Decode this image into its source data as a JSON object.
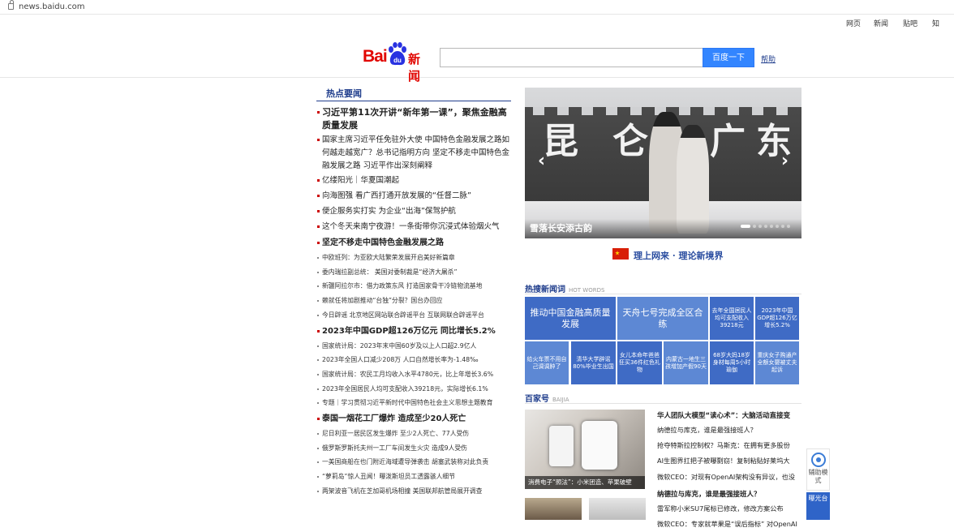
{
  "browser": {
    "url": "news.baidu.com"
  },
  "topnav": [
    "网页",
    "新闻",
    "贴吧",
    "知"
  ],
  "header": {
    "logo_bai": "Bai",
    "logo_du": "du",
    "logo_news": "新闻",
    "search_value": "",
    "search_button": "百度一下",
    "help": "帮助"
  },
  "left": {
    "section_title": "热点要闻",
    "headline1": "习近平第11次开讲“新年第一课”，聚焦金融高质量发展",
    "items1": [
      "国家主席习近平任免驻外大使  中国特色金融发展之路如何越走越宽广？总书记指明方向  坚定不移走中国特色金融发展之路 习近平作出深刻阐释",
      "亿缕阳光｜华夏国潮起",
      "向海图强 看广西打通开放发展的“任督二脉”",
      "便企服务实打实 为企业“出海”保驾护航",
      "这个冬天来南宁夜游！一条街带你沉浸式体验烟火气"
    ],
    "headline2": "坚定不移走中国特色金融发展之路",
    "subs2": [
      "中欧班列：为亚欧大陆繁荣发展开启美好新篇章",
      "委内瑞拉副总统： 美国对委制裁是“经济大屠杀”",
      "新疆阿拉尔市：借力政策东风 打造国家骨干冷链物流基地",
      "赖就任将加剧推动“台独”分裂？国台办回应",
      "今日辟谣 北京地区网站联合辟谣平台 互联网联合辟谣平台"
    ],
    "headline3": "2023年中国GDP超126万亿元 同比增长5.2%",
    "subs3": [
      "国家统计局：2023年末中国60岁及以上人口超2.9亿人",
      "2023年全国人口减少208万 人口自然增长率为-1.48‰",
      "国家统计局：农民工月均收入水平4780元，比上年增长3.6%",
      "2023年全国居民人均可支配收入39218元，实际增长6.1%",
      "专题｜学习贯彻习近平新时代中国特色社会主义思想主题教育"
    ],
    "headline4": "泰国一烟花工厂爆炸 造成至少20人死亡",
    "subs4": [
      "尼日利亚一居民区发生爆炸 至少2人死亡、77人受伤",
      "俄罗斯罗斯托夫州一工厂车间发生火灾 造成9人受伤",
      "一美国商船在也门附近海域遭导弹袭击 胡塞武装称对此负责",
      "“萝莉岛”惊人丑闻！曝泼斯坦员工透露骇人细节",
      "两架波音飞机在芝加哥机场相撞 美国联邦航管局展开调查"
    ]
  },
  "slide": {
    "caption": "雪落长安添古韵",
    "wall_chars": [
      "昆",
      "仑",
      "广",
      "东"
    ],
    "prev": "‹",
    "next": "›"
  },
  "banner": {
    "text": "理上网来 · 理论新境界"
  },
  "hotwords": {
    "title": "热搜新闻词",
    "en": "HOT WORDS",
    "cells": [
      "推动中国金融高质量发展",
      "天舟七号完成全区合练",
      "去年全国居民人均可支配收入39218元",
      "2023年中国GDP超126万亿 增长5.2%",
      "给火车票不用自己调调肿了",
      "清华大学辟谣80%毕业生出国",
      "女儿本命年爸爸狂买36件红色礼物",
      "内蒙古一地生三孩增加产假90天",
      "68岁大妈18岁身材每周5小时瑜伽",
      "重庆女子购通产全额女婴被丈夫起诉"
    ]
  },
  "baijia": {
    "title": "百家号",
    "en": "BAIJIA",
    "thumb_caption": "消费电子“照法”：小米团造、苹果破壁",
    "headline1": "华人团队大模型“读心术”：大脑活动直接变",
    "list1": [
      "纳德拉与库克，谁是最强接班人？",
      "抢夺特斯拉控制权？马斯克：在拥有更多股份",
      "AI生图界扛把子被曝剽窃！复制粘贴好莱坞大",
      "微软CEO：对现有OpenAI架构没有异议，也没"
    ],
    "headline2": "纳德拉与库克，谁是最强接班人？",
    "list2": [
      "雷军称小米SU7尾标已修改，修改方案公布",
      "微软CEO：专家就苹果是“误后指标” 对OpenAI"
    ]
  },
  "floats": {
    "assist": "辅助模式",
    "report": "曝光台"
  },
  "colors": {
    "accent": "#3385ff",
    "brand_red": "#e10601",
    "nav_blue": "#1f3d8c",
    "tile_blue": "#3f6bc5",
    "tile_light": "#5d88d4"
  }
}
